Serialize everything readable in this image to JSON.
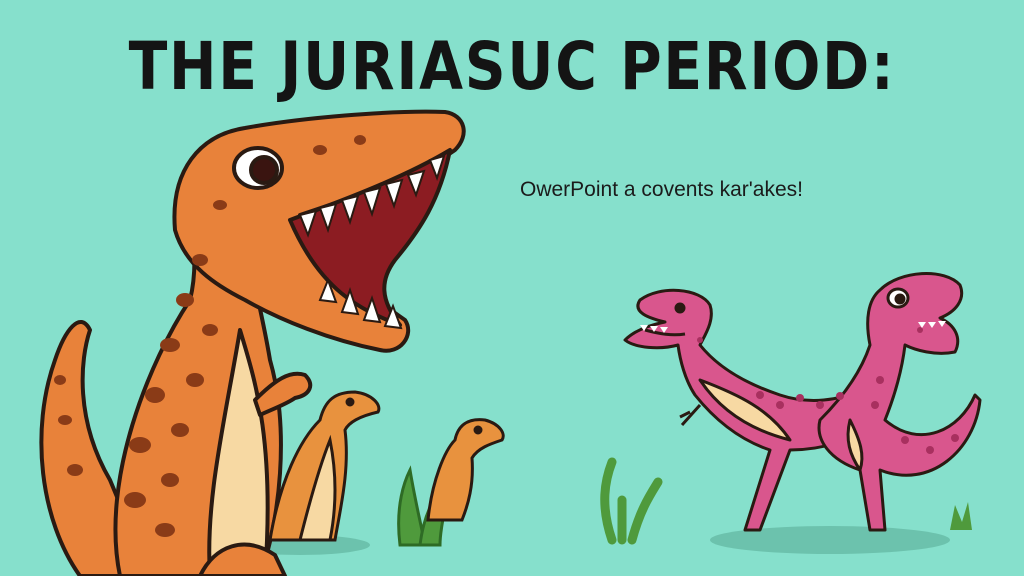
{
  "slide": {
    "title": "THE JURIASUC PERIOD:",
    "subtitle": "OwerPoint a covents kar'akes!"
  },
  "colors": {
    "background": "#86e0cc",
    "trex_orange": "#e8823a",
    "trex_spots": "#8a3b17",
    "belly_cream": "#f7d9a3",
    "raptor_pink": "#d9568d",
    "raptor_spots": "#a8305f",
    "plant_green": "#4f9a3c",
    "outline": "#2a1a12"
  },
  "icons": [
    "trex-icon",
    "small-dino-icon",
    "raptor-icon",
    "plant-icon"
  ]
}
